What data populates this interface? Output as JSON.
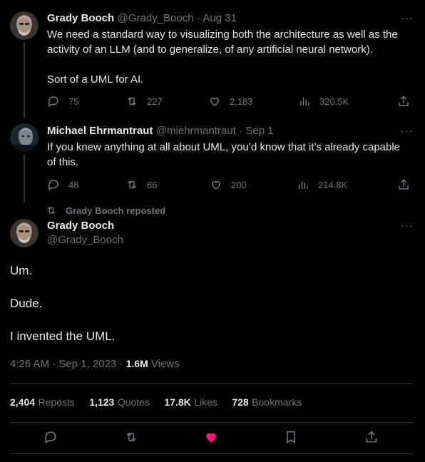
{
  "tweet1": {
    "name": "Grady Booch",
    "handle": "@Grady_Booch",
    "date": "· Aug 31",
    "more": "···",
    "text_line1": "We need a standard way to visualizing both the architecture as well as the",
    "text_line2": "activity of an LLM (and to generalize, of any artificial neural network).",
    "text_line3": "Sort of a UML for AI.",
    "replies": "75",
    "reposts": "227",
    "likes": "2,183",
    "views": "320.5K"
  },
  "tweet2": {
    "name": "Michael Ehrmantraut",
    "handle": "@miehrmantraut",
    "date": "· Sep 1",
    "more": "···",
    "text_line1": "If you knew anything at all about UML, you’d know that it’s already capable",
    "text_line2": "of this.",
    "replies": "48",
    "reposts": "86",
    "likes": "200",
    "views": "214.8K"
  },
  "main": {
    "reposted_by": "Grady Booch reposted",
    "name": "Grady Booch",
    "handle": "@Grady_Booch",
    "more": "···",
    "line1": "Um.",
    "line2": "Dude.",
    "line3": "I invented the UML.",
    "timestamp": "4:26 AM · Sep 1, 2023 · ",
    "views_count": "1.6M",
    "views_label": " Views"
  },
  "stats": {
    "reposts_num": "2,404",
    "reposts_lbl": "Reposts",
    "quotes_num": "1,123",
    "quotes_lbl": "Quotes",
    "likes_num": "17.8K",
    "likes_lbl": "Likes",
    "bookmarks_num": "728",
    "bookmarks_lbl": "Bookmarks"
  },
  "colors": {
    "liked": "#f91880",
    "muted": "#71767b"
  }
}
